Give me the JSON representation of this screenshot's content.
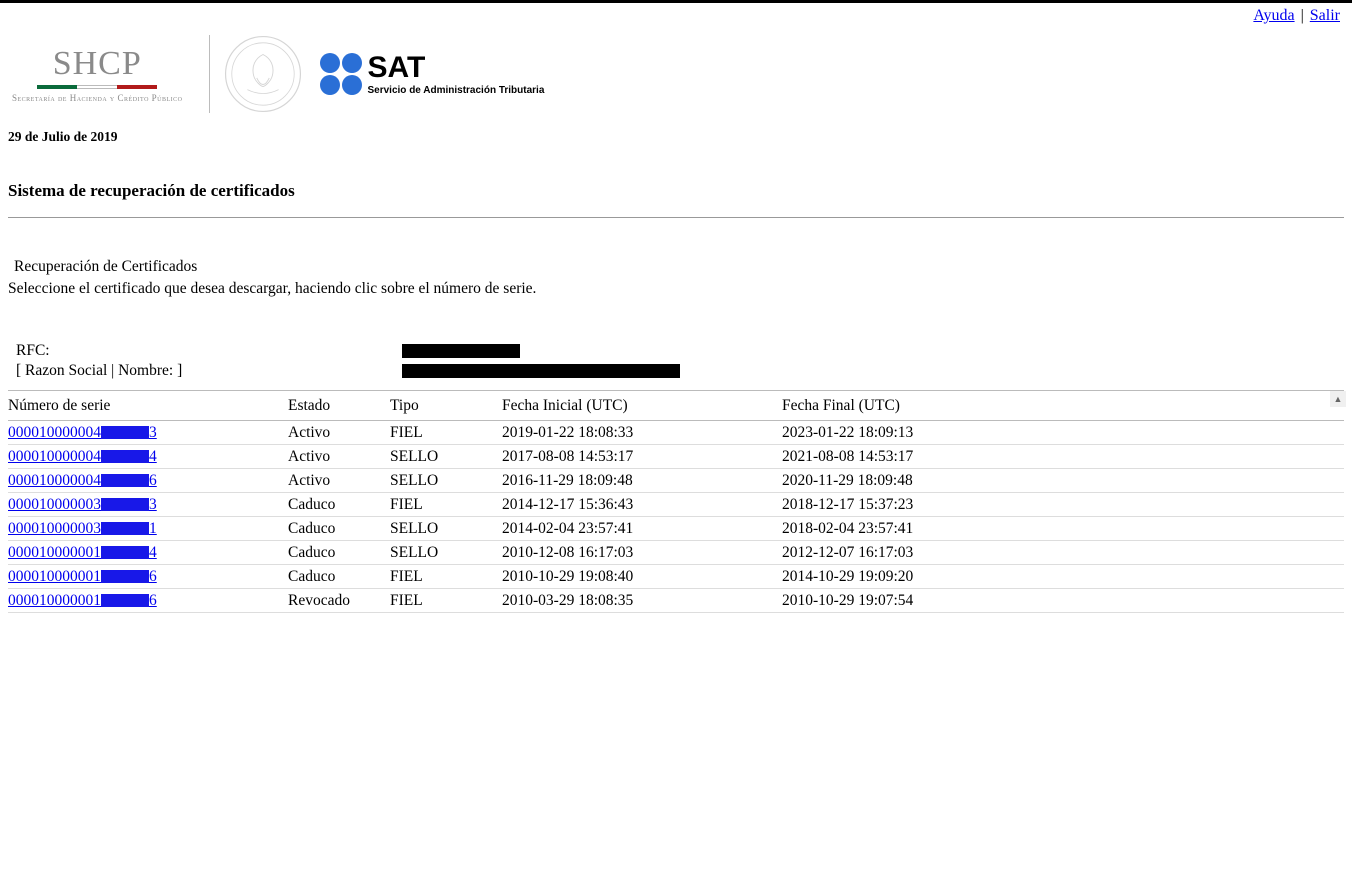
{
  "topnav": {
    "help_label": "Ayuda",
    "exit_label": "Salir"
  },
  "logos": {
    "shcp_main": "SHCP",
    "shcp_sub": "Secretaría de Hacienda\ny Crédito Público",
    "sat_main": "SAT",
    "sat_sub": "Servicio de Administración Tributaria"
  },
  "date_line": "29 de Julio de 2019",
  "page_title": "Sistema de recuperación de certificados",
  "section": {
    "heading": "Recuperación de Certificados",
    "instruction": "Seleccione el certificado que desea descargar, haciendo clic sobre el número de serie."
  },
  "info": {
    "rfc_label": "RFC:",
    "razon_label": "[ Razon Social | Nombre: ]"
  },
  "table": {
    "headers": {
      "serie": "Número de serie",
      "estado": "Estado",
      "tipo": "Tipo",
      "finicial": "Fecha Inicial (UTC)",
      "ffinal": "Fecha Final (UTC)"
    },
    "rows": [
      {
        "serie_prefix": "000010000004",
        "serie_suffix": "3",
        "estado": "Activo",
        "tipo": "FIEL",
        "fi": "2019-01-22 18:08:33",
        "ff": "2023-01-22 18:09:13"
      },
      {
        "serie_prefix": "000010000004",
        "serie_suffix": "4",
        "estado": "Activo",
        "tipo": "SELLO",
        "fi": "2017-08-08 14:53:17",
        "ff": "2021-08-08 14:53:17"
      },
      {
        "serie_prefix": "000010000004",
        "serie_suffix": "6",
        "estado": "Activo",
        "tipo": "SELLO",
        "fi": "2016-11-29 18:09:48",
        "ff": "2020-11-29 18:09:48"
      },
      {
        "serie_prefix": "000010000003",
        "serie_suffix": "3",
        "estado": "Caduco",
        "tipo": "FIEL",
        "fi": "2014-12-17 15:36:43",
        "ff": "2018-12-17 15:37:23"
      },
      {
        "serie_prefix": "000010000003",
        "serie_suffix": "1",
        "estado": "Caduco",
        "tipo": "SELLO",
        "fi": "2014-02-04 23:57:41",
        "ff": "2018-02-04 23:57:41"
      },
      {
        "serie_prefix": "000010000001",
        "serie_suffix": "4",
        "estado": "Caduco",
        "tipo": "SELLO",
        "fi": "2010-12-08 16:17:03",
        "ff": "2012-12-07 16:17:03"
      },
      {
        "serie_prefix": "000010000001",
        "serie_suffix": "6",
        "estado": "Caduco",
        "tipo": "FIEL",
        "fi": "2010-10-29 19:08:40",
        "ff": "2014-10-29 19:09:20"
      },
      {
        "serie_prefix": "000010000001",
        "serie_suffix": "6",
        "estado": "Revocado",
        "tipo": "FIEL",
        "fi": "2010-03-29 18:08:35",
        "ff": "2010-10-29 19:07:54"
      }
    ]
  }
}
